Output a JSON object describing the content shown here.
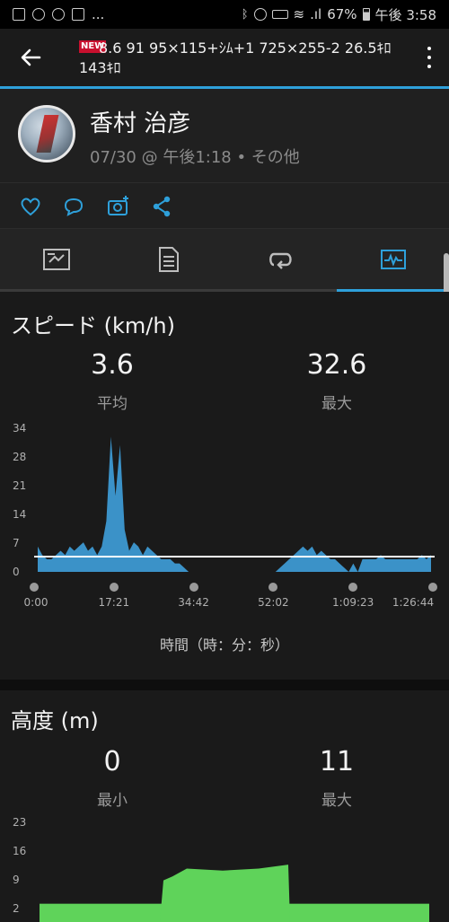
{
  "status_bar": {
    "right_text": "67%",
    "time": "午後 3:58",
    "dots": "..."
  },
  "app_bar": {
    "new_badge": "NEW",
    "title": "8.6 91 95×115+ｼﾑ+1 725×255-2 26.5ｷﾛ 143ｷﾛ",
    "back_icon": "arrow-left-icon",
    "menu_icon": "more-vert-icon"
  },
  "profile": {
    "name": "香村 治彦",
    "meta": "07/30 @ 午後1:18 • その他"
  },
  "actions": {
    "like_icon": "heart-icon",
    "comment_icon": "comment-icon",
    "photo_icon": "add-photo-icon",
    "share_icon": "share-icon"
  },
  "tabs": [
    {
      "icon": "map-icon"
    },
    {
      "icon": "details-icon"
    },
    {
      "icon": "laps-icon"
    },
    {
      "icon": "chart-icon",
      "selected": true
    }
  ],
  "speed_card": {
    "title": "スピード (km/h)",
    "avg_value": "3.6",
    "avg_label": "平均",
    "max_value": "32.6",
    "max_label": "最大",
    "axis_title": "時間（時：分：秒）"
  },
  "elevation_card": {
    "title": "高度 (m)",
    "min_value": "0",
    "min_label": "最小",
    "max_value": "11",
    "max_label": "最大"
  },
  "chart_data": [
    {
      "type": "area",
      "title": "スピード (km/h)",
      "xlabel": "時間（時：分：秒）",
      "y_ticks": [
        "34",
        "28",
        "21",
        "14",
        "7",
        "0"
      ],
      "x_ticks": [
        "0:00",
        "17:21",
        "34:42",
        "52:02",
        "1:09:23",
        "1:26:44"
      ],
      "ylim": [
        0,
        34
      ],
      "x_minutes": [
        0,
        1,
        2,
        3,
        4,
        5,
        6,
        7,
        8,
        9,
        10,
        11,
        12,
        13,
        14,
        15,
        16,
        17,
        18,
        19,
        20,
        21,
        22,
        23,
        24,
        25,
        26,
        27,
        28,
        29,
        30,
        31,
        32,
        33,
        34,
        35,
        36,
        37,
        38,
        39,
        40,
        41,
        42,
        43,
        44,
        45,
        46,
        47,
        48,
        49,
        50,
        51,
        52,
        53,
        54,
        55,
        56,
        57,
        58,
        59,
        60,
        61,
        62,
        63,
        64,
        65,
        66,
        67,
        68,
        69,
        70,
        71,
        72,
        73,
        74,
        75,
        76,
        77,
        78,
        79,
        80,
        81,
        82,
        83,
        84,
        85,
        86
      ],
      "values": [
        6,
        4,
        3,
        3,
        4,
        5,
        4,
        6,
        5,
        6,
        7,
        5,
        6,
        4,
        6,
        12,
        32,
        18,
        30,
        10,
        5,
        7,
        6,
        4,
        6,
        5,
        4,
        3,
        3,
        3,
        2,
        2,
        1,
        0,
        0,
        0,
        0,
        0,
        0,
        0,
        0,
        0,
        0,
        0,
        0,
        0,
        0,
        0,
        0,
        0,
        0,
        0,
        0,
        1,
        2,
        3,
        4,
        5,
        6,
        5,
        6,
        4,
        5,
        4,
        3,
        3,
        2,
        1,
        0,
        2,
        0,
        3,
        3,
        3,
        3,
        4,
        3,
        3,
        3,
        3,
        3,
        3,
        3,
        3,
        4,
        3,
        4
      ],
      "average": 3.6,
      "color": "#3b92c8"
    },
    {
      "type": "area",
      "title": "高度 (m)",
      "y_ticks": [
        "23",
        "16",
        "9",
        "2"
      ],
      "ylim": [
        0,
        23
      ],
      "color": "#5fd35a"
    }
  ]
}
